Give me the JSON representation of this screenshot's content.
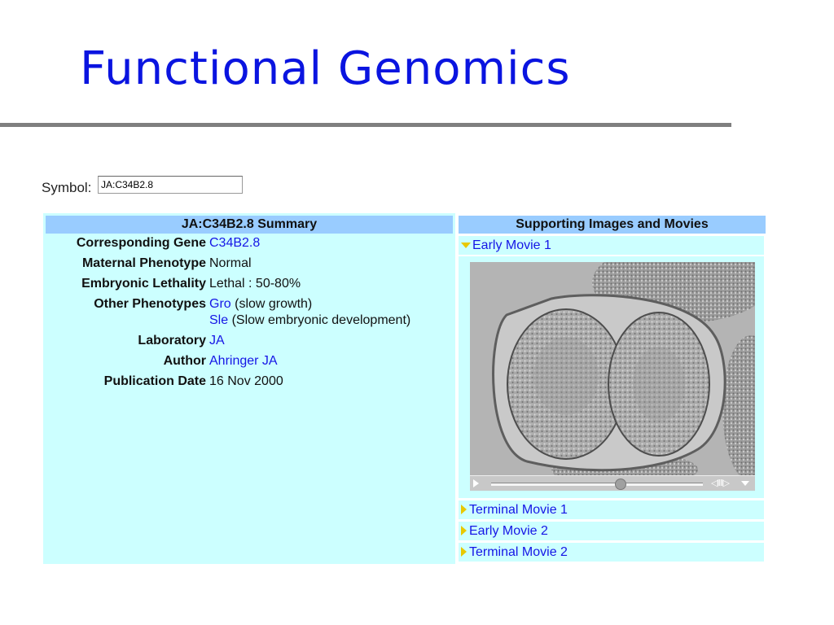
{
  "slide": {
    "title": "Functional Genomics"
  },
  "symbol": {
    "label": "Symbol:",
    "value": "JA:C34B2.8"
  },
  "summary": {
    "header": "JA:C34B2.8 Summary",
    "rows": [
      {
        "label": "Corresponding Gene",
        "value": "C34B2.8"
      },
      {
        "label": "Maternal Phenotype",
        "value": "Normal"
      },
      {
        "label": "Embryonic Lethality",
        "value": "Lethal : 50-80%"
      },
      {
        "label": "Other Phenotypes",
        "value_1_link": "Gro",
        "value_1_text": " (slow growth)",
        "value_2_link": "Sle",
        "value_2_text": " (Slow embryonic development)"
      },
      {
        "label": "Laboratory",
        "value": "JA"
      },
      {
        "label": "Author",
        "value": "Ahringer JA"
      },
      {
        "label": "Publication Date",
        "value": "16 Nov 2000"
      }
    ]
  },
  "media": {
    "header": "Supporting Images and Movies",
    "items": [
      {
        "label": "Early Movie 1",
        "expanded": true
      },
      {
        "label": "Terminal Movie 1",
        "expanded": false
      },
      {
        "label": "Early Movie 2",
        "expanded": false
      },
      {
        "label": "Terminal Movie 2",
        "expanded": false
      }
    ],
    "video": {
      "image": "embryo-dic-microscopy-image",
      "player_icons": [
        "play-icon",
        "seek-bar",
        "step-back-icon",
        "step-forward-icon",
        "menu-icon"
      ]
    }
  },
  "colors": {
    "title": "#0a14e0",
    "panel_bg": "#ccffff",
    "header_bg": "#99ccff",
    "link": "#1515e6",
    "rule": "#7f7f7f",
    "triangle": "#e8c800"
  }
}
